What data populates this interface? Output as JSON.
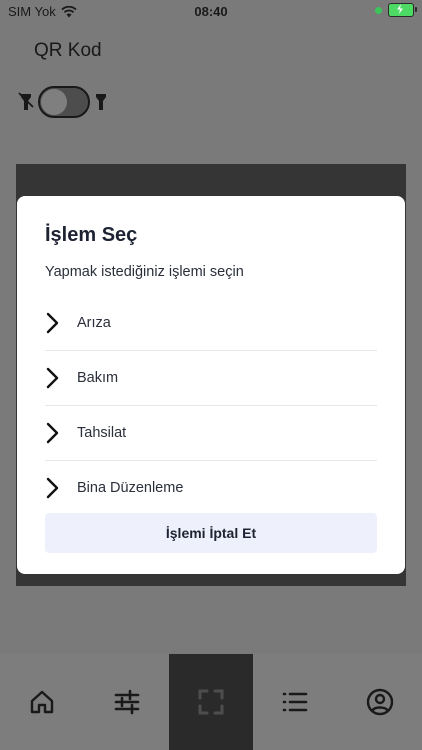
{
  "status_bar": {
    "carrier": "SIM Yok",
    "time": "08:40"
  },
  "app": {
    "title": "QR Kod"
  },
  "flash_toggle": {
    "state": "off"
  },
  "tabs": [
    {
      "icon": "home-icon",
      "active": false
    },
    {
      "icon": "sliders-icon",
      "active": false
    },
    {
      "icon": "scan-frame-icon",
      "active": true
    },
    {
      "icon": "list-icon",
      "active": false
    },
    {
      "icon": "profile-icon",
      "active": false
    }
  ],
  "dialog": {
    "title": "İşlem Seç",
    "subtitle": "Yapmak istediğiniz işlemi seçin",
    "options": [
      {
        "label": "Arıza"
      },
      {
        "label": "Bakım"
      },
      {
        "label": "Tahsilat"
      },
      {
        "label": "Bina Düzenleme"
      }
    ],
    "cancel_label": "İşlemi İptal Et"
  },
  "colors": {
    "overlay": "#808080",
    "cancel_bg": "#eef0fb",
    "active_tab": "#555555",
    "title_text": "#1e2333"
  }
}
